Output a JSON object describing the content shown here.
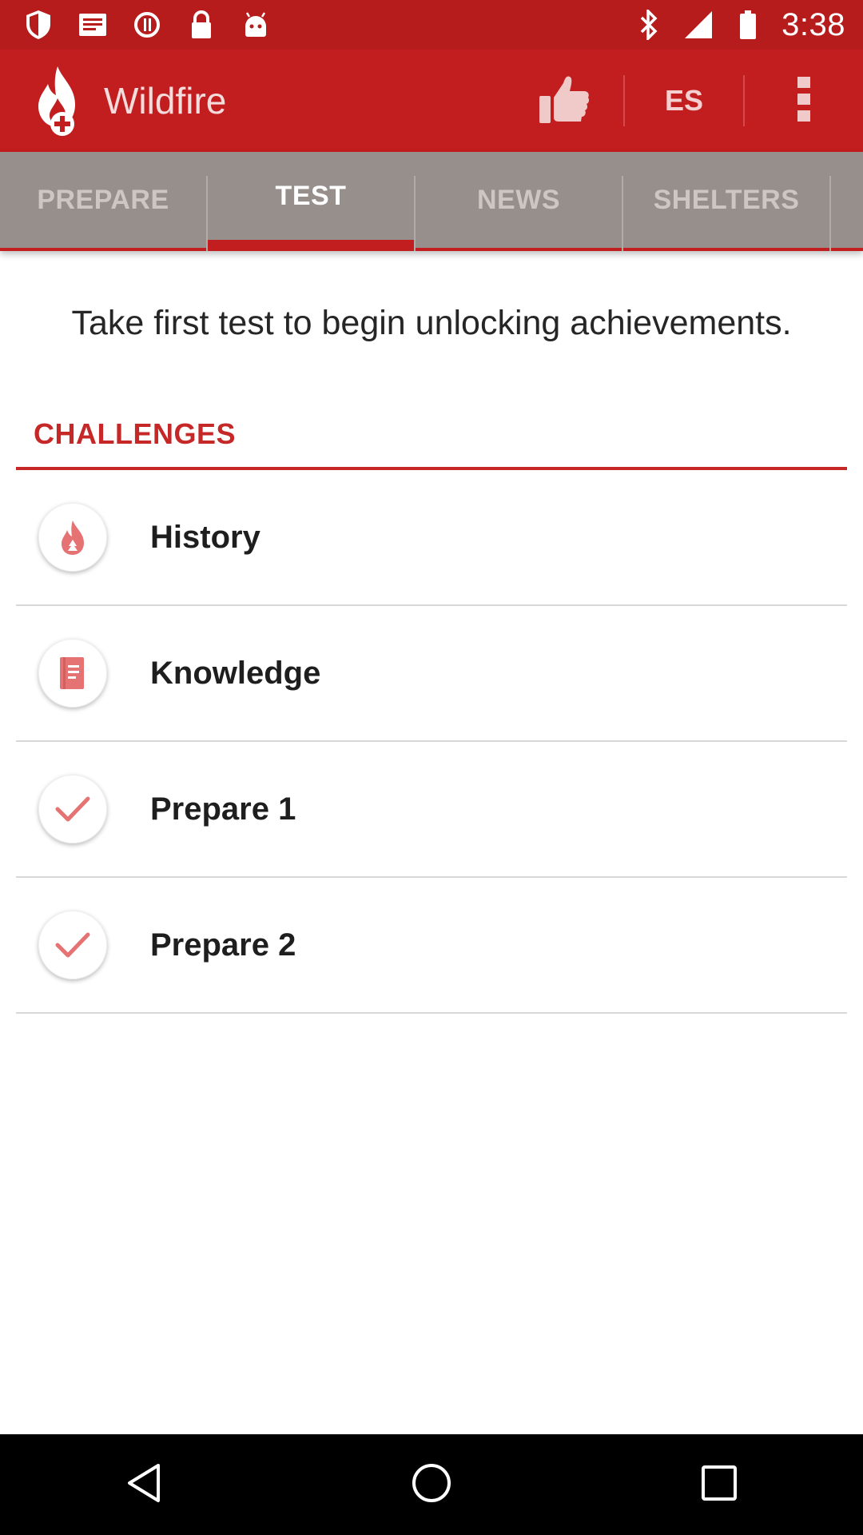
{
  "status_bar": {
    "time": "3:38",
    "left_icons": [
      "shield-icon",
      "notification-icon",
      "sync-icon",
      "lock-icon",
      "android-icon"
    ],
    "right_icons": [
      "bluetooth-icon",
      "signal-icon",
      "battery-icon"
    ]
  },
  "app_bar": {
    "title": "Wildfire",
    "logo_icon": "wildfire-logo-icon",
    "like_icon": "thumbs-up-icon",
    "language_label": "ES",
    "menu_icon": "overflow-menu-icon"
  },
  "tabs": [
    {
      "label": "PREPARE",
      "active": false
    },
    {
      "label": "TEST",
      "active": true
    },
    {
      "label": "NEWS",
      "active": false
    },
    {
      "label": "SHELTERS",
      "active": false
    }
  ],
  "main": {
    "notice": "Take first test to begin unlocking achievements.",
    "section_title": "CHALLENGES",
    "challenges": [
      {
        "label": "History",
        "icon": "flame-icon"
      },
      {
        "label": "Knowledge",
        "icon": "book-icon"
      },
      {
        "label": "Prepare 1",
        "icon": "checkmark-icon"
      },
      {
        "label": "Prepare 2",
        "icon": "checkmark-icon"
      }
    ]
  },
  "colors": {
    "status_bar": "#b71c1c",
    "app_bar": "#c21d1f",
    "tab_bar": "#968f8b",
    "accent": "#c62828"
  },
  "nav_bar": {
    "icons": [
      "back-icon",
      "home-icon",
      "recents-icon"
    ]
  }
}
